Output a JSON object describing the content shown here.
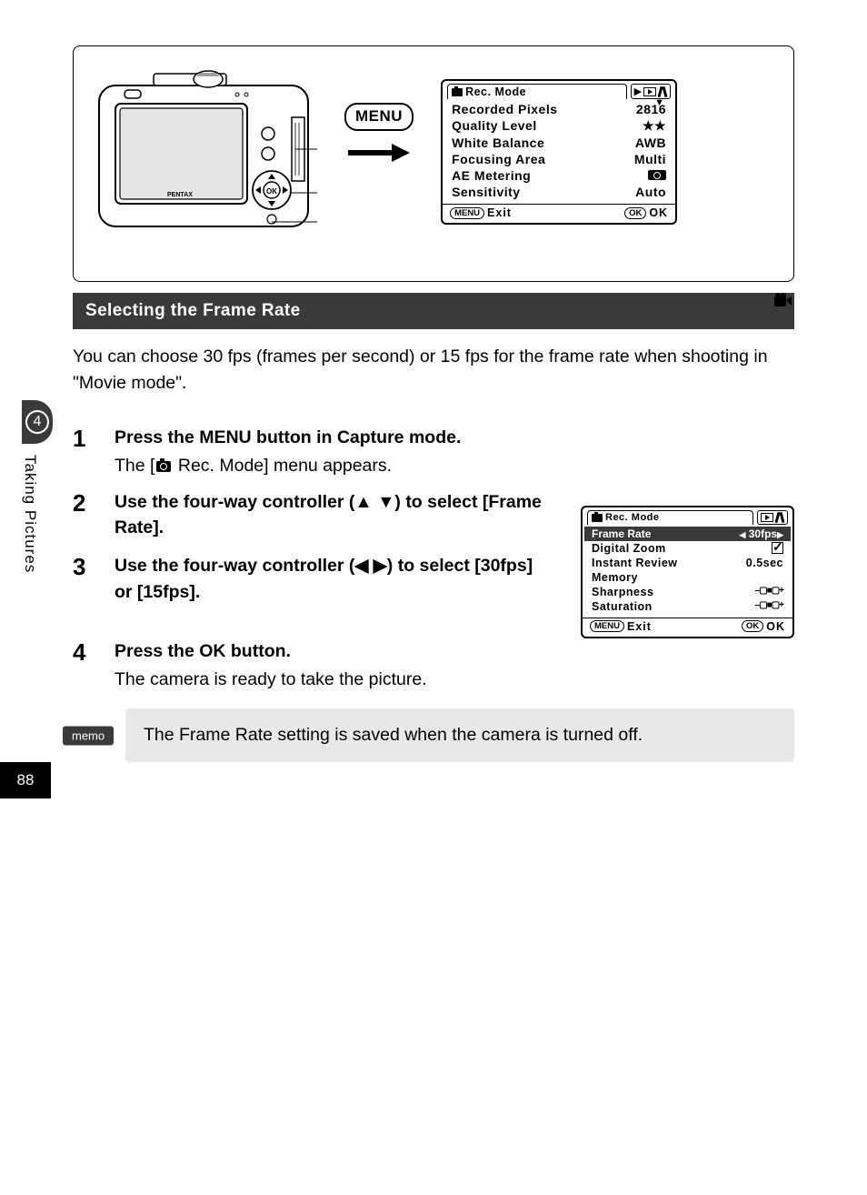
{
  "page_number": "88",
  "side_badge_num": "4",
  "side_label": "Taking Pictures",
  "top": {
    "menu_button_label": "MENU"
  },
  "menu1": {
    "tab_label": "Rec. Mode",
    "items": [
      {
        "label": "Recorded Pixels",
        "value": "2816"
      },
      {
        "label": "Quality Level",
        "value": "★★"
      },
      {
        "label": "White Balance",
        "value": "AWB"
      },
      {
        "label": "Focusing Area",
        "value": "Multi"
      },
      {
        "label": "AE Metering",
        "value": "metering"
      },
      {
        "label": "Sensitivity",
        "value": "Auto"
      }
    ],
    "footer_left": "Exit",
    "footer_left_pill": "MENU",
    "footer_right": "OK",
    "footer_right_pill": "OK"
  },
  "menu2": {
    "tab_label": "Rec. Mode",
    "highlight": {
      "label": "Frame Rate",
      "value": "30fps"
    },
    "items": [
      {
        "label": "Digital Zoom",
        "value": "check"
      },
      {
        "label": "Instant Review",
        "value": "0.5sec"
      },
      {
        "label": "Memory",
        "value": ""
      },
      {
        "label": "Sharpness",
        "value": "slider"
      },
      {
        "label": "Saturation",
        "value": "slider"
      }
    ],
    "footer_left": "Exit",
    "footer_left_pill": "MENU",
    "footer_right": "OK",
    "footer_right_pill": "OK"
  },
  "section_title": "Selecting the Frame Rate",
  "intro": "You can choose 30 fps (frames per second) or 15 fps for the frame rate when shooting in \"Movie mode\".",
  "steps": {
    "s1": {
      "num": "1",
      "title": "Press the MENU button in Capture mode.",
      "desc_pre": "The [",
      "desc_post": " Rec. Mode] menu appears."
    },
    "s2": {
      "num": "2",
      "title_pre": "Use the four-way controller (",
      "title_mid": ") to select [Frame Rate].",
      "arrows": "▲ ▼"
    },
    "s3": {
      "num": "3",
      "title_pre": "Use the four-way controller (",
      "title_mid": ") to select [30fps] or [15fps].",
      "arrows": "◀ ▶"
    },
    "s4": {
      "num": "4",
      "title": "Press the OK button.",
      "desc": "The camera is ready to take the picture."
    }
  },
  "memo": {
    "label": "memo",
    "text": "The Frame Rate setting is saved when the camera is turned off."
  }
}
